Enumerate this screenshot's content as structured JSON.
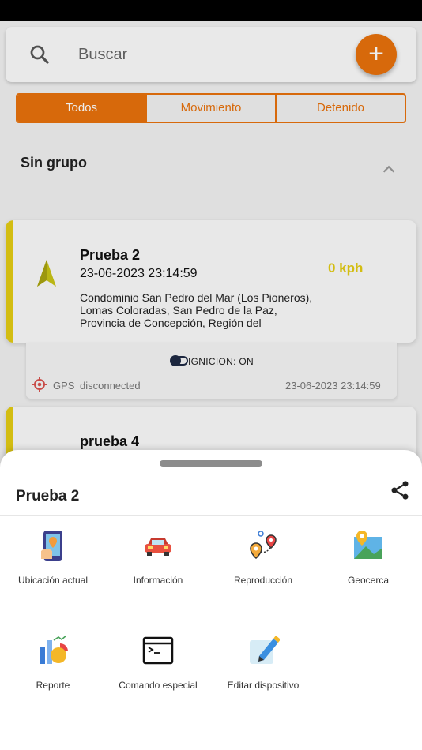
{
  "search": {
    "placeholder": "Buscar"
  },
  "fab": {
    "label": "+"
  },
  "segments": [
    {
      "label": "Todos",
      "active": true
    },
    {
      "label": "Movimiento",
      "active": false
    },
    {
      "label": "Detenido",
      "active": false
    }
  ],
  "group": {
    "title": "Sin grupo"
  },
  "device1": {
    "name": "Prueba 2",
    "datetime": "23-06-2023 23:14:59",
    "speed": "0 kph",
    "address": "Condominio San Pedro del Mar (Los Pioneros), Lomas Coloradas, San Pedro de la Paz, Provincia de Concepción, Región del",
    "ignition": "IGNICION: ON",
    "gps_label": "GPS",
    "gps_status": "disconnected",
    "gps_time": "23-06-2023 23:14:59"
  },
  "device2": {
    "name": "prueba 4"
  },
  "sheet": {
    "title": "Prueba 2",
    "actions": [
      {
        "label": "Ubicación actual",
        "icon": "current-location-icon"
      },
      {
        "label": "Información",
        "icon": "car-icon"
      },
      {
        "label": "Reproducción",
        "icon": "route-playback-icon"
      },
      {
        "label": "Geocerca",
        "icon": "geofence-map-icon"
      },
      {
        "label": "Reporte",
        "icon": "report-chart-icon"
      },
      {
        "label": "Comando especial",
        "icon": "terminal-icon"
      },
      {
        "label": "Editar dispositivo",
        "icon": "edit-icon"
      }
    ]
  },
  "colors": {
    "accent": "#e8720c",
    "status_yellow": "#e3cc14"
  }
}
